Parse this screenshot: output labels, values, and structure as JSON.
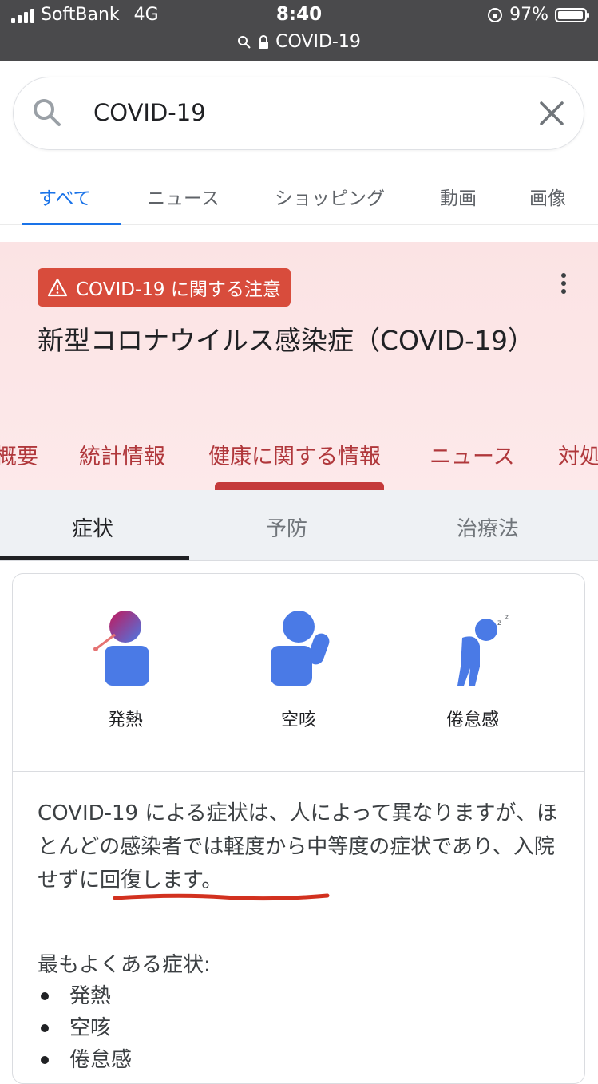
{
  "status_bar": {
    "carrier": "SoftBank",
    "network": "4G",
    "time": "8:40",
    "battery": "97%",
    "battery_level": 0.97,
    "url": "COVID-19"
  },
  "search": {
    "query": "COVID-19"
  },
  "google_tabs": [
    "すべて",
    "ニュース",
    "ショッピング",
    "動画",
    "画像"
  ],
  "alert": {
    "badge": "COVID-19 に関する注意",
    "title": "新型コロナウイルス感染症（COVID-19）",
    "subtabs": [
      "概要",
      "統計情報",
      "健康に関する情報",
      "ニュース",
      "対処"
    ]
  },
  "symptom_tabs": [
    "症状",
    "予防",
    "治療法"
  ],
  "symptoms": [
    {
      "label": "発熱",
      "icon": "fever-icon"
    },
    {
      "label": "空咳",
      "icon": "dry-cough-icon"
    },
    {
      "label": "倦怠感",
      "icon": "fatigue-icon"
    }
  ],
  "description": {
    "lead": "COVID-19 による症状は、人によって異なりますが、ほとんどの感染者では軽度から中等度の症状であり、",
    "highlight": "入院せずに回復します",
    "tail": "。"
  },
  "common": {
    "title": "最もよくある症状:",
    "items": [
      "発熱",
      "空咳",
      "倦怠感"
    ]
  },
  "colors": {
    "accent_blue": "#1a73e8",
    "alert_red": "#d84c3c",
    "annotation_red": "#d2311f",
    "icon_blue": "#4a7ae6"
  }
}
